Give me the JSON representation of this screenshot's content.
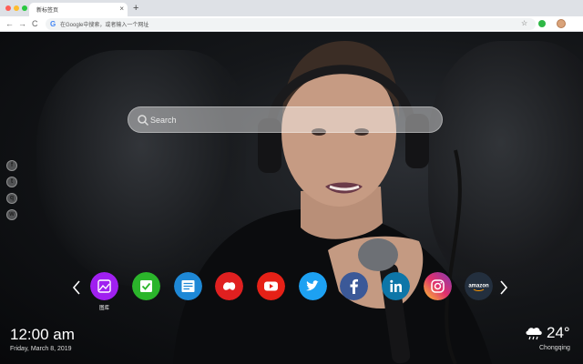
{
  "browser": {
    "tab_title": "新标签页",
    "tab_close": "×",
    "new_tab": "+",
    "omnibox_placeholder": "在Google中搜索，或者输入一个网址",
    "nav": {
      "back": "←",
      "forward": "→",
      "reload": "C"
    },
    "star": "☆",
    "menu": "⋮",
    "window_dot_colors": [
      "#ff5f57",
      "#febc2e",
      "#28c840"
    ]
  },
  "search": {
    "placeholder": "Search"
  },
  "social": [
    {
      "name": "facebook-icon",
      "glyph": "f"
    },
    {
      "name": "twitter-icon",
      "glyph": "t"
    },
    {
      "name": "qq-icon",
      "glyph": "q"
    },
    {
      "name": "wechat-icon",
      "glyph": "w"
    }
  ],
  "apps": [
    {
      "name": "gallery-app",
      "label": "图库",
      "color": "#a020f0"
    },
    {
      "name": "checklist-app",
      "label": "",
      "color": "#2bb52b"
    },
    {
      "name": "notes-app",
      "label": "",
      "color": "#1e88d6"
    },
    {
      "name": "games-app",
      "label": "",
      "color": "#e02020"
    },
    {
      "name": "youtube-app",
      "label": "",
      "color": "#e62117"
    },
    {
      "name": "twitter-app",
      "label": "",
      "color": "#1da1f2"
    },
    {
      "name": "facebook-app",
      "label": "",
      "color": "#3b5998"
    },
    {
      "name": "linkedin-app",
      "label": "",
      "color": "#0e76a8"
    },
    {
      "name": "instagram-app",
      "label": "",
      "color": "#d6249f"
    },
    {
      "name": "amazon-app",
      "label": "amazon",
      "color": "#232f3e"
    }
  ],
  "clock": {
    "time": "12:00 am",
    "date": "Friday, March 8, 2019"
  },
  "weather": {
    "temp": "24°",
    "city": "Chongqing",
    "icon": "cloud-rain-icon"
  }
}
